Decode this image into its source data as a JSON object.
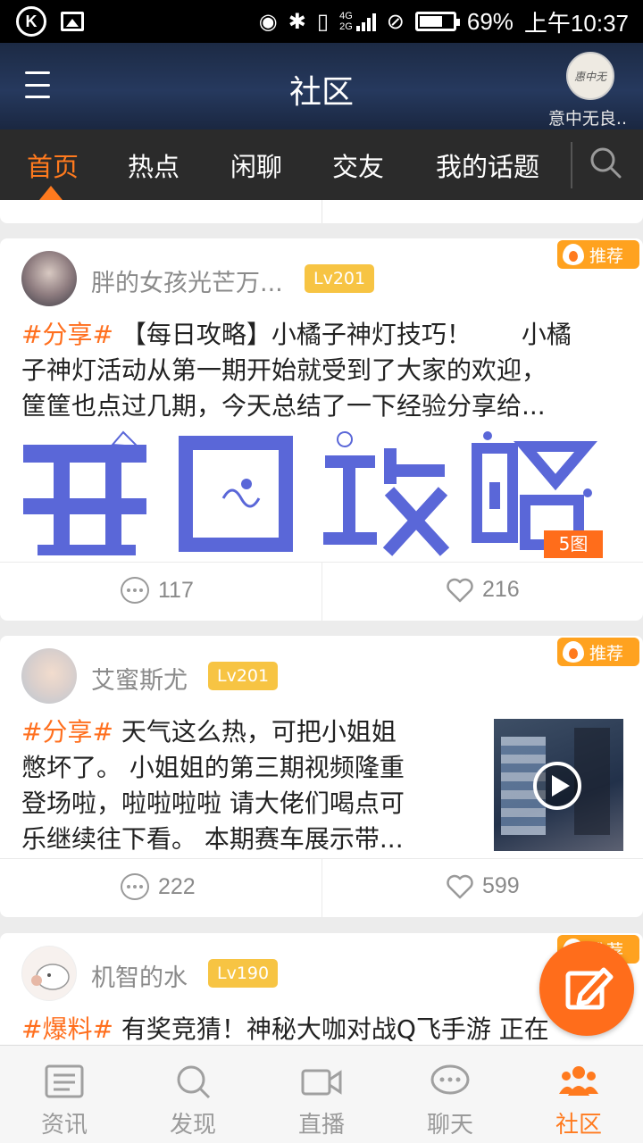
{
  "status_bar": {
    "network": "4G",
    "network2": "2G",
    "battery": "69%",
    "battery_level": 0.69,
    "time": "上午10:37"
  },
  "header": {
    "title": "社区",
    "username": "意中无良..",
    "avatar_text": "惠中无"
  },
  "tabs": [
    {
      "label": "首页",
      "active": true
    },
    {
      "label": "热点",
      "active": false
    },
    {
      "label": "闲聊",
      "active": false
    },
    {
      "label": "交友",
      "active": false
    },
    {
      "label": "我的话题",
      "active": false
    }
  ],
  "posts": [
    {
      "username": "胖的女孩光芒万...",
      "level": "Lv201",
      "badge": "推荐",
      "tag": "#分享#",
      "line1": " 【每日攻略】小橘子神灯技巧！　　小橘",
      "line2": "子神灯活动从第一期开始就受到了大家的欢迎，",
      "line3": "筐筐也点过几期，今天总结了一下经验分享给...",
      "image_chars": [
        "每",
        "日",
        "攻",
        "略"
      ],
      "photo_count": "5图",
      "comments": "117",
      "likes": "216"
    },
    {
      "username": "艾蜜斯尤",
      "level": "Lv201",
      "badge": "推荐",
      "tag": "#分享#",
      "line1": " 天气这么热，可把小姐姐",
      "line2": "憋坏了。 小姐姐的第三期视频隆重",
      "line3": "登场啦，啦啦啦啦 请大佬们喝点可",
      "line4": "乐继续往下看。 本期赛车展示带...",
      "comments": "222",
      "likes": "599"
    },
    {
      "username": "机智的水",
      "level": "Lv190",
      "badge": "推荐",
      "tag": "#爆料#",
      "line1": " 有奖竞猜！神秘大咖对战Q飞手游 正在"
    }
  ],
  "bottom_nav": [
    {
      "label": "资讯",
      "icon": "news-icon",
      "active": false
    },
    {
      "label": "发现",
      "icon": "search-icon",
      "active": false
    },
    {
      "label": "直播",
      "icon": "video-camera-icon",
      "active": false
    },
    {
      "label": "聊天",
      "icon": "chat-bubble-icon",
      "active": false
    },
    {
      "label": "社区",
      "icon": "people-icon",
      "active": true
    }
  ],
  "colors": {
    "accent": "#ff7a1e",
    "level_badge": "#f7c443",
    "tab_bar": "#2b2b2b"
  }
}
